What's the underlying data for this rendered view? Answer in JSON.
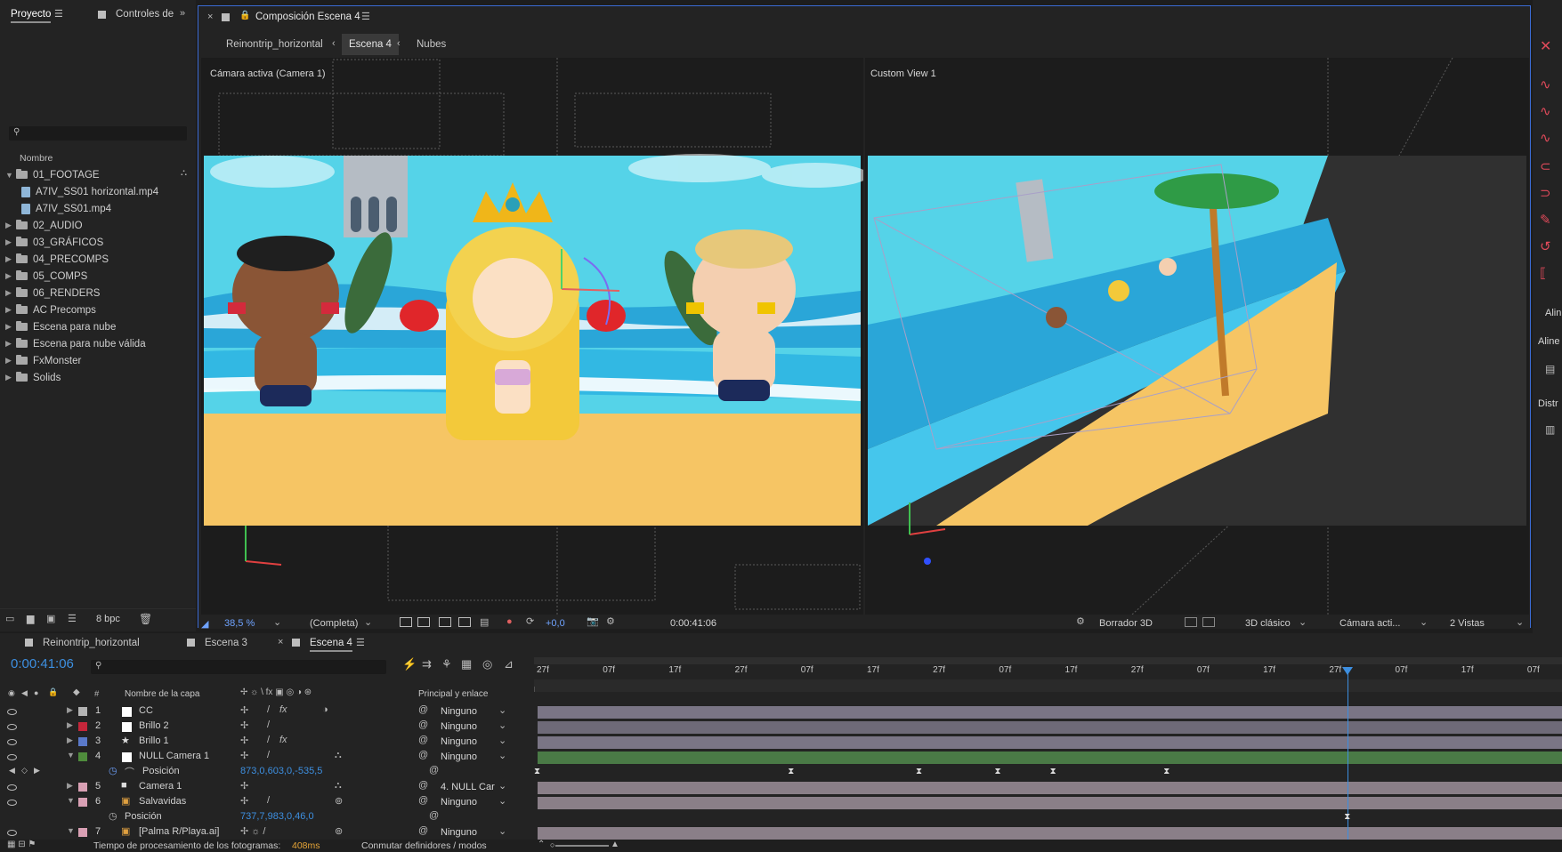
{
  "project_panel": {
    "tabs": [
      "Proyecto",
      "Controles de"
    ],
    "search_placeholder": "",
    "column_name": "Nombre",
    "items": [
      {
        "name": "01_FOOTAGE",
        "type": "folder",
        "open": true
      },
      {
        "name": "A7IV_SS01 horizontal.mp4",
        "type": "file"
      },
      {
        "name": "A7IV_SS01.mp4",
        "type": "file"
      },
      {
        "name": "02_AUDIO",
        "type": "folder"
      },
      {
        "name": "03_GRÁFICOS",
        "type": "folder"
      },
      {
        "name": "04_PRECOMPS",
        "type": "folder"
      },
      {
        "name": "05_COMPS",
        "type": "folder"
      },
      {
        "name": "06_RENDERS",
        "type": "folder"
      },
      {
        "name": "AC Precomps",
        "type": "folder"
      },
      {
        "name": "Escena para nube",
        "type": "folder"
      },
      {
        "name": "Escena para nube válida",
        "type": "folder"
      },
      {
        "name": "FxMonster",
        "type": "folder"
      },
      {
        "name": "Solids",
        "type": "folder"
      }
    ],
    "bpc": "8 bpc"
  },
  "comp_panel": {
    "title": "Composición Escena 4",
    "breadcrumbs": [
      "Reinontrip_horizontal",
      "Escena 4",
      "Nubes"
    ],
    "view_left_label": "Cámara activa (Camera 1)",
    "view_right_label": "Custom View 1",
    "footer": {
      "zoom": "38,5 %",
      "resolution": "(Completa)",
      "exposure": "+0,0",
      "timecode": "0:00:41:06",
      "renderer": "Borrador 3D",
      "mode": "3D clásico",
      "camera": "Cámara acti...",
      "views": "2 Vistas"
    }
  },
  "right_panel": {
    "labels": [
      "Alin",
      "Aline",
      "Distr"
    ]
  },
  "timeline": {
    "tabs": [
      "Reinontrip_horizontal",
      "Escena 3",
      "Escena 4"
    ],
    "timecode": "0:00:41:06",
    "search_placeholder": "",
    "col_layer_name": "Nombre de la capa",
    "col_parent": "Principal y enlace",
    "col_num": "#",
    "ruler": [
      "27f",
      "07f",
      "17f",
      "27f",
      "07f",
      "17f",
      "27f",
      "07f",
      "17f",
      "27f",
      "07f",
      "17f",
      "27f",
      "07f",
      "17f",
      "07f"
    ],
    "playhead_fraction": 0.795,
    "layers": [
      {
        "num": "1",
        "name": "CC",
        "color": "#b3b3b3",
        "parent": "Ninguno",
        "bar_color": "#7a7585",
        "fx": true
      },
      {
        "num": "2",
        "name": "Brillo 2",
        "color": "#c4263a",
        "parent": "Ninguno",
        "bar_color": "#6e6a78",
        "fx": false
      },
      {
        "num": "3",
        "name": "Brillo 1",
        "color": "#5a79c9",
        "parent": "Ninguno",
        "bar_color": "#7a7585",
        "fx": true
      },
      {
        "num": "4",
        "name": "NULL Camera 1",
        "color": "#4f8c3c",
        "parent": "Ninguno",
        "bar_color": "#4a7a46",
        "fx": false
      },
      {
        "num": "5",
        "name": "Camera 1",
        "color": "#d9a0b4",
        "parent": "4. NULL Car",
        "bar_color": "#8a7f88",
        "fx": false
      },
      {
        "num": "6",
        "name": "Salvavidas",
        "color": "#d9a0b4",
        "parent": "Ninguno",
        "bar_color": "#8a7f88",
        "fx": false
      },
      {
        "num": "7",
        "name": "[Palma R/Playa.ai]",
        "color": "#d9a0b4",
        "parent": "Ninguno",
        "bar_color": "#8a7f88",
        "fx": false
      }
    ],
    "prop_position_label": "Posición",
    "null_position": "873,0,603,0,-535,5",
    "salvavidas_position": "737,7,983,0,46,0",
    "status_text": "Tiempo de procesamiento de los fotogramas:",
    "status_value": "408ms",
    "toggle_label": "Conmutar definidores / modos"
  },
  "colors": {
    "accent": "#3b6bd4",
    "timecode_blue": "#3d8fe0",
    "panel_bg": "#232323",
    "sky": "#55d3e8",
    "sand": "#f6c564"
  }
}
